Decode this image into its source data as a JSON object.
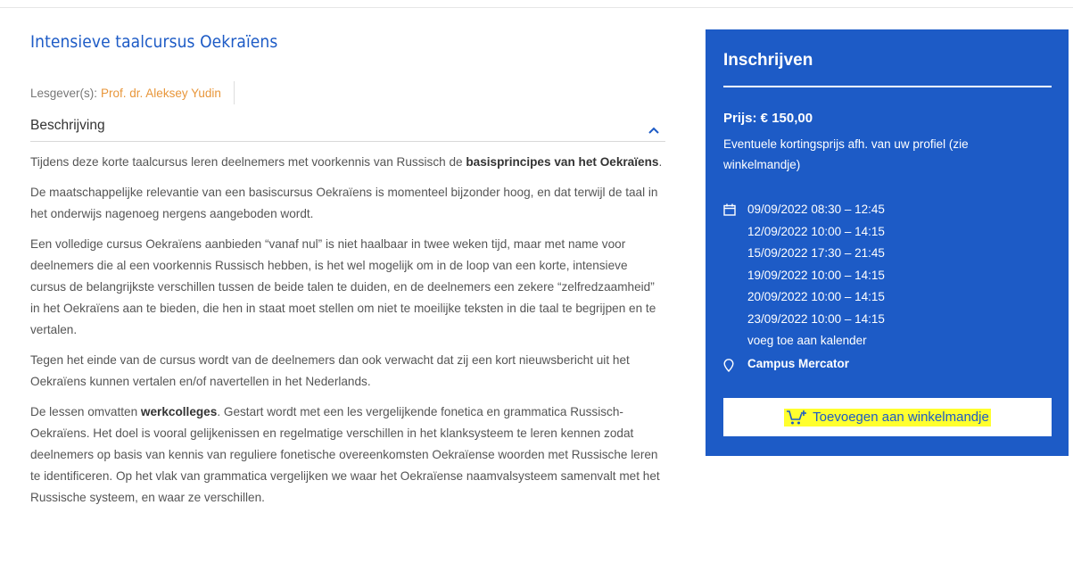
{
  "course": {
    "title": "Intensieve taalcursus Oekraïens",
    "teacher_label": "Lesgever(s):",
    "teacher_name": "Prof. dr. Aleksey Yudin"
  },
  "description": {
    "heading": "Beschrijving",
    "toggle_icon": "chevron-up-icon",
    "paragraphs": [
      {
        "before": "Tijdens deze korte taalcursus leren deelnemers met voorkennis van Russisch de ",
        "bold": "basisprincipes van het Oekraïens",
        "after": "."
      },
      {
        "before": "De maatschappelijke relevantie van een basiscursus Oekraïens is momenteel bijzonder hoog, en dat terwijl de taal in het onderwijs nagenoeg nergens aangeboden wordt.",
        "bold": "",
        "after": ""
      },
      {
        "before": "Een volledige cursus Oekraïens aanbieden “vanaf nul” is niet haalbaar in twee weken tijd, maar met name voor deelnemers die al een voorkennis Russisch hebben, is het wel mogelijk om in de loop van een korte, intensieve cursus de belangrijkste verschillen tussen de beide talen te duiden, en de deelnemers een zekere “zelfredzaamheid” in het Oekraïens aan te bieden, die hen in staat moet stellen om niet te moeilijke teksten in die taal te begrijpen en te vertalen.",
        "bold": "",
        "after": ""
      },
      {
        "before": "Tegen het einde van de cursus wordt van de deelnemers dan ook verwacht dat zij een kort nieuwsbericht uit het Oekraïens kunnen vertalen en/of navertellen in het Nederlands.",
        "bold": "",
        "after": ""
      },
      {
        "before": "De lessen omvatten ",
        "bold": "werkcolleges",
        "after": ". Gestart wordt met een les vergelijkende fonetica en grammatica Russisch-Oekraïens. Het doel is vooral gelijkenissen en regelmatige verschillen in het klanksysteem te leren kennen zodat deelnemers op basis van kennis van reguliere fonetische overeenkomsten Oekraïense woorden met Russische leren te identificeren. Op het vlak van grammatica vergelijken we waar het Oekraïense naamvalsysteem samenvalt met het Russische systeem, en waar ze verschillen."
      }
    ]
  },
  "signup": {
    "title": "Inschrijven",
    "price": "Prijs: € 150,00",
    "discount_note": "Eventuele kortingsprijs afh. van uw profiel (zie winkelmandje)",
    "dates": [
      "09/09/2022 08:30 – 12:45",
      "12/09/2022 10:00 – 14:15",
      "15/09/2022 17:30 – 21:45",
      "19/09/2022 10:00 – 14:15",
      "20/09/2022 10:00 – 14:15",
      "23/09/2022 10:00 – 14:15"
    ],
    "calendar_link": "voeg toe aan kalender",
    "location": "Campus Mercator",
    "cart_button": "Toevoegen aan winkelmandje",
    "calendar_icon": "calendar-icon",
    "location_icon": "map-pin-icon",
    "cart_icon": "cart-add-icon"
  },
  "colors": {
    "brand_blue": "#1d5bc6",
    "teacher_link": "#e8963a",
    "highlight": "#ffff2e"
  }
}
